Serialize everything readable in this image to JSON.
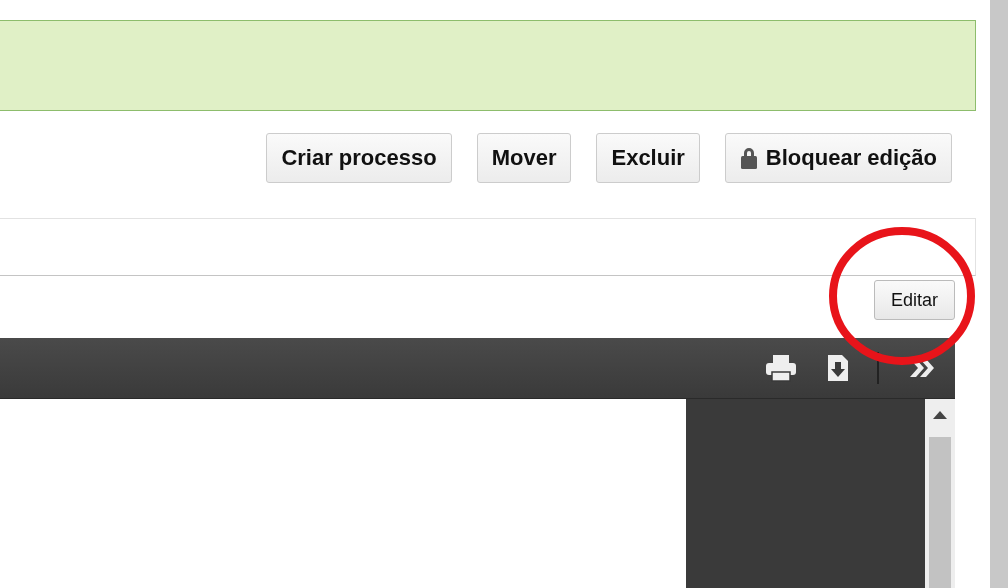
{
  "actions": [
    {
      "label": "Criar processo",
      "kind": "plain"
    },
    {
      "label": "Mover",
      "kind": "plain"
    },
    {
      "label": "Excluir",
      "kind": "plain"
    },
    {
      "label": "Bloquear edição",
      "kind": "lock"
    }
  ],
  "edit_button": {
    "label": "Editar"
  }
}
